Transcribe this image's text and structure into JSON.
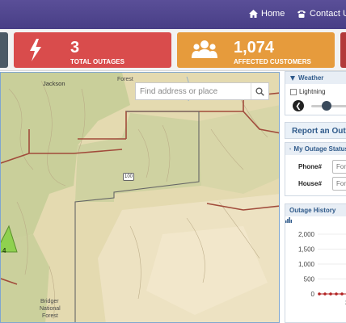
{
  "nav": {
    "home_label": "Home",
    "contact_label": "Contact Us"
  },
  "stats": {
    "outages": {
      "value": "3",
      "label": "TOTAL OUTAGES"
    },
    "customers": {
      "value": "1,074",
      "label": "AFFECTED CUSTOMERS"
    }
  },
  "map": {
    "search_placeholder": "Find address or place",
    "labels": {
      "town": "Jackson",
      "forest_top": "Forest",
      "route": "100",
      "bnf_line1": "Bridger",
      "bnf_line2": "National",
      "bnf_line3": "Forest",
      "marker_count": "4"
    },
    "marker_color": "#8fd14f"
  },
  "weather": {
    "title": "Weather",
    "lightning_label": "Lightning"
  },
  "report": {
    "title": "Report an Outage"
  },
  "my_status": {
    "title": "My Outage Status",
    "phone_label": "Phone#",
    "phone_placeholder": "Format",
    "house_label": "House#",
    "house_placeholder": "Format"
  },
  "history": {
    "title": "Outage History"
  },
  "chart_data": {
    "type": "line",
    "yticks": [
      0,
      500,
      1000,
      1500,
      2000
    ],
    "ylim": [
      0,
      2000
    ],
    "series": [
      {
        "values": [
          0,
          0,
          0,
          0,
          0,
          0
        ]
      }
    ],
    "x_partial_label": "2"
  },
  "colors": {
    "topbar": "#4d4390",
    "outages_card": "#d94c4c",
    "customers_card": "#e69b3c",
    "panel_header_text": "#2f5a8a",
    "series_line": "#b22222"
  }
}
